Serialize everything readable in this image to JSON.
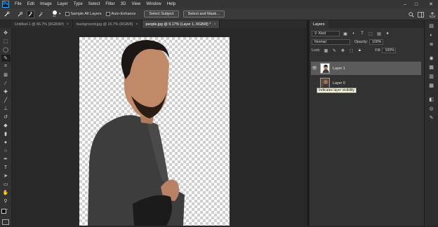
{
  "app": {
    "logo": "Ps"
  },
  "menu": [
    "File",
    "Edit",
    "Image",
    "Layer",
    "Type",
    "Select",
    "Filter",
    "3D",
    "View",
    "Window",
    "Help"
  ],
  "window_controls": {
    "minimize": "–",
    "maximize": "□",
    "close": "✕"
  },
  "options": {
    "sample_all_layers": "Sample All Layers",
    "auto_enhance": "Auto-Enhance",
    "brush_size": "41",
    "select_subject": "Select Subject",
    "select_and_mask": "Select and Mask..."
  },
  "tabs": [
    {
      "label": "Untitled-1 @ 66.7% (RGB/8#)",
      "close": "×"
    },
    {
      "label": "background.jpg @ 16.7% (RGB/8)",
      "close": "×"
    },
    {
      "label": "people.jpg @ 9.17% (Layer 1, RGB/8) *",
      "close": "×"
    }
  ],
  "layers_panel": {
    "tab": "Layers",
    "kind": "Kind",
    "blend_mode": "Normal",
    "opacity_label": "Opacity:",
    "opacity_value": "100%",
    "lock_label": "Lock:",
    "fill_label": "Fill:",
    "fill_value": "100%",
    "layers": [
      {
        "name": "Layer 1",
        "active": true
      },
      {
        "name": "Layer 0",
        "active": false
      }
    ]
  },
  "tooltip": "Indicates layer visibility",
  "icons": {
    "tools": [
      "move-icon",
      "artboard-icon",
      "lasso-icon",
      "quick-selection-icon",
      "crop-icon",
      "frame-icon",
      "eyedropper-icon",
      "healing-brush-icon",
      "brush-icon",
      "clone-stamp-icon",
      "history-brush-icon",
      "eraser-icon",
      "gradient-icon",
      "blur-icon",
      "dodge-icon",
      "pen-icon",
      "type-icon",
      "path-selection-icon",
      "rectangle-icon",
      "hand-icon",
      "zoom-icon",
      "more-tools-icon"
    ]
  },
  "colors": {
    "ui_bg": "#282828",
    "panel": "#323232",
    "selected_layer": "#5b5b5b",
    "accent": "#31a8ff"
  }
}
